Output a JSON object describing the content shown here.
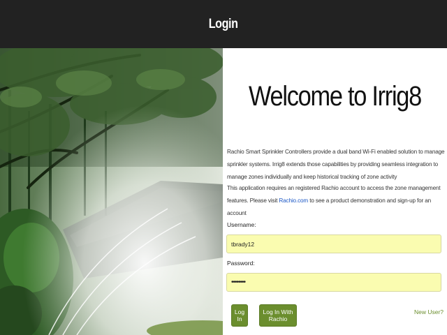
{
  "header": {
    "title": "Login"
  },
  "hero": {
    "image_description_icon": "sprinkler-photo",
    "colors": {
      "foliage": "#2f4a2a",
      "sky": "#dfe6dc",
      "spray": "#f2f4ef",
      "lawn": "#6f8f3a"
    }
  },
  "panel": {
    "welcome": "Welcome to Irrig8",
    "paragraph1": "Rachio Smart Sprinkler Controllers provide a dual band Wi-Fi enabled solution to manage sprinkler systems. Irrig8 extends those capabilities by providing seamless integration to manage zones individually and keep historical tracking of zone activity",
    "paragraph2_before": "This application requires an registered Rachio account to access the zone management features. Please visit ",
    "paragraph2_link": "Rachio.com",
    "paragraph2_after": " to see a product demonstration and sign-up for an account"
  },
  "form": {
    "username_label": "Username:",
    "username_value": "tbrady12",
    "password_label": "Password:",
    "password_value": "tbrady12",
    "login_button": "Log In",
    "rachio_button": "Log In With Rachio",
    "new_user_link": "New User?"
  },
  "colors": {
    "header_bg": "#222222",
    "button_green": "#6b8e2e",
    "input_bg": "#fafcb0",
    "link_blue": "#1a56c5"
  }
}
